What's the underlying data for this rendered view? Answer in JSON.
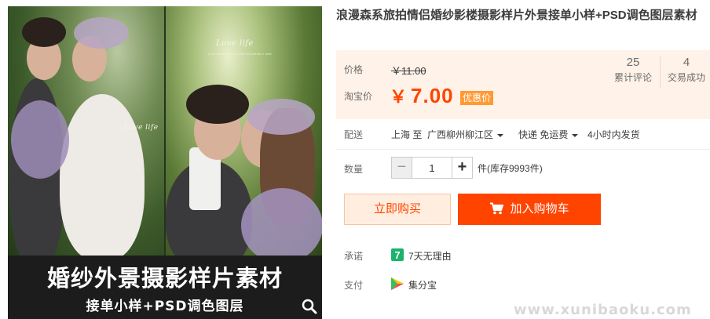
{
  "gallery": {
    "love_text_left": "Love life",
    "love_text_right": "Love life",
    "love_sub": "Love means that I know the person I love",
    "banner_title": "婚纱外景摄影样片素材",
    "banner_sub": "接单小样+PSD调色图层",
    "zoom_icon": "magnifier-icon"
  },
  "product": {
    "title": "浪漫森系旅拍情侣婚纱影楼摄影样片外景接单小样+PSD调色图层素材"
  },
  "price": {
    "label": "价格",
    "original": "￥11.00",
    "taobao_label": "淘宝价",
    "currency": "￥",
    "current": "7.00",
    "promo_tag": "优惠价",
    "accent_color": "#ff4400"
  },
  "stats": {
    "reviews_count": "25",
    "reviews_label": "累计评论",
    "deals_count": "4",
    "deals_label": "交易成功"
  },
  "shipping": {
    "label": "配送",
    "from": "上海 至",
    "to": "广西柳州柳江区",
    "method": "快递 免运费",
    "dispatch": "4小时内发货"
  },
  "quantity": {
    "label": "数量",
    "value": "1",
    "minus": "−",
    "plus": "+",
    "stock": "件(库存9993件)"
  },
  "actions": {
    "buy_now": "立即购买",
    "add_to_cart": "加入购物车",
    "cart_icon": "cart-icon"
  },
  "promise": {
    "label": "承诺",
    "badge_char": "7",
    "text": "7天无理由",
    "badge_color": "#1bb26c"
  },
  "payment": {
    "label": "支付",
    "text": "集分宝",
    "icon": "jifenbao-icon"
  },
  "watermark": "www.xunibaoku.com"
}
